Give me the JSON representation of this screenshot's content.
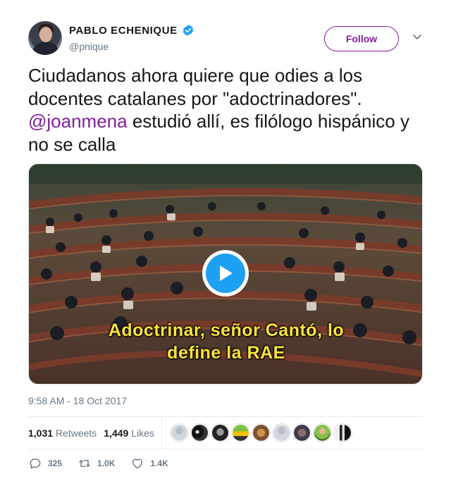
{
  "author": {
    "display_name": "PABLO ECHENIQUE",
    "handle": "@pnique",
    "verified": true
  },
  "follow_button": {
    "label": "Follow"
  },
  "tweet": {
    "text_before_mention": "Ciudadanos ahora quiere que odies a los docentes catalanes por \"adoctrinadores\". ",
    "mention": "@joanmena",
    "text_after_mention": " estudió allí, es filólogo hispánico y no se calla"
  },
  "media": {
    "caption_line1": "Adoctrinar, señor Cantó, lo",
    "caption_line2": "define la RAE"
  },
  "timestamp": "9:58 AM - 18 Oct 2017",
  "stats": {
    "retweets_count": "1,031",
    "retweets_label": "Retweets",
    "likes_count": "1,449",
    "likes_label": "Likes"
  },
  "actions": {
    "replies": "325",
    "retweets": "1.0K",
    "likes": "1.4K"
  },
  "colors": {
    "accent": "#7f1f9a",
    "verified": "#1da1f2",
    "muted": "#657786",
    "caption": "#f7e53a"
  }
}
